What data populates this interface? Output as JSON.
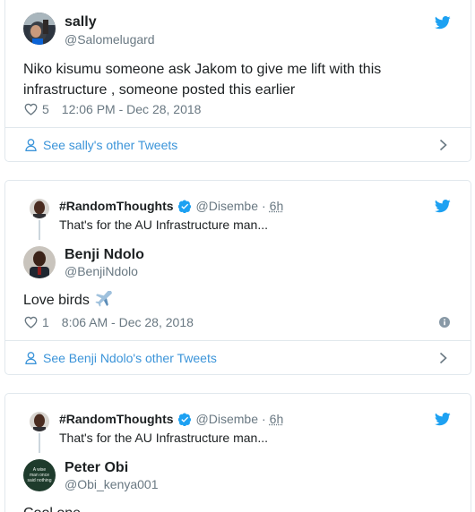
{
  "colors": {
    "twitter_blue": "#1da1f2",
    "link_blue": "#3b94d9",
    "muted_gray": "#697882",
    "border": "#e1e8ed",
    "text": "#1c2022"
  },
  "tweets": [
    {
      "author_name": "sally",
      "author_handle": "@Salomelugard",
      "text": "Niko kisumu someone ask Jakom to give me lift with this infrastructure , someone posted this earlier",
      "likes": "5",
      "timestamp": "12:06 PM - Dec 28, 2018",
      "footer_link": "See sally's other Tweets",
      "icons": [
        "twitter-bird-icon",
        "heart-icon",
        "person-icon",
        "chevron-right-icon"
      ]
    },
    {
      "context": {
        "name": "#RandomThoughts",
        "handle": "@Disembe",
        "dot": "·",
        "time": "6h",
        "text": "That's for the AU Infrastructure man..."
      },
      "author_name": "Benji Ndolo",
      "author_handle": "@BenjiNdolo",
      "text": "Love birds",
      "emoji": "airplane",
      "likes": "1",
      "timestamp": "8:06 AM - Dec 28, 2018",
      "footer_link": "See Benji Ndolo's other Tweets",
      "icons": [
        "twitter-bird-icon",
        "verified-icon",
        "heart-icon",
        "info-icon",
        "person-icon",
        "chevron-right-icon"
      ]
    },
    {
      "context": {
        "name": "#RandomThoughts",
        "handle": "@Disembe",
        "dot": "·",
        "time": "6h",
        "text": "That's for the AU Infrastructure man..."
      },
      "author_name": "Peter Obi",
      "author_handle": "@Obi_kenya001",
      "avatar_text": "A wise man once said nothing",
      "text": "Cool one",
      "icons": [
        "twitter-bird-icon",
        "verified-icon"
      ]
    }
  ]
}
